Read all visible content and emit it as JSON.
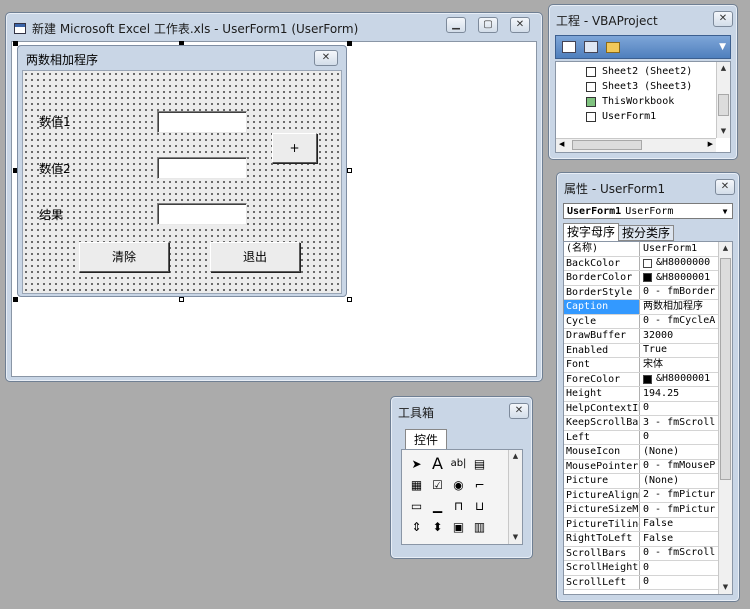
{
  "editor_window": {
    "title": "新建 Microsoft Excel 工作表.xls - UserForm1 (UserForm)"
  },
  "userform": {
    "caption": "两数相加程序",
    "labels": {
      "value1": "数值1",
      "value2": "数值2",
      "result": "结果"
    },
    "buttons": {
      "add": "+",
      "clear": "清除",
      "exit": "退出"
    }
  },
  "project_window": {
    "title": "工程 - VBAProject",
    "tree_items": [
      {
        "label": "Sheet2 (Sheet2)",
        "icon": "sheet-icon"
      },
      {
        "label": "Sheet3 (Sheet3)",
        "icon": "sheet-icon"
      },
      {
        "label": "ThisWorkbook",
        "icon": "workbook-icon"
      },
      {
        "label": "UserForm1",
        "icon": "userform-icon"
      }
    ]
  },
  "properties_window": {
    "title": "属性 - UserForm1",
    "object_select": {
      "name": "UserForm1",
      "type": "UserForm"
    },
    "tabs": [
      "按字母序",
      "按分类序"
    ],
    "rows": [
      {
        "name": "(名称)",
        "value": "UserForm1"
      },
      {
        "name": "BackColor",
        "value": "&H8000000",
        "swatch": "#ffffff"
      },
      {
        "name": "BorderColor",
        "value": "&H8000001",
        "swatch": "#000000"
      },
      {
        "name": "BorderStyle",
        "value": "0 - fmBorder"
      },
      {
        "name": "Caption",
        "value": "两数相加程序",
        "selected": true
      },
      {
        "name": "Cycle",
        "value": "0 - fmCycleA"
      },
      {
        "name": "DrawBuffer",
        "value": "32000"
      },
      {
        "name": "Enabled",
        "value": "True"
      },
      {
        "name": "Font",
        "value": "宋体"
      },
      {
        "name": "ForeColor",
        "value": "&H8000001",
        "swatch": "#000000"
      },
      {
        "name": "Height",
        "value": "194.25"
      },
      {
        "name": "HelpContextID",
        "value": "0"
      },
      {
        "name": "KeepScrollBar",
        "value": "3 - fmScroll"
      },
      {
        "name": "Left",
        "value": "0"
      },
      {
        "name": "MouseIcon",
        "value": "(None)"
      },
      {
        "name": "MousePointer",
        "value": "0 - fmMouseP"
      },
      {
        "name": "Picture",
        "value": "(None)"
      },
      {
        "name": "PictureAlignm",
        "value": "2 - fmPictur"
      },
      {
        "name": "PictureSizeMo",
        "value": "0 - fmPictur"
      },
      {
        "name": "PictureTiling",
        "value": "False"
      },
      {
        "name": "RightToLeft",
        "value": "False"
      },
      {
        "name": "ScrollBars",
        "value": "0 - fmScroll"
      },
      {
        "name": "ScrollHeight",
        "value": "0"
      },
      {
        "name": "ScrollLeft",
        "value": "0"
      }
    ]
  },
  "toolbox": {
    "title": "工具箱",
    "tab": "控件",
    "tools": [
      {
        "icon": "pointer-icon",
        "glyph": "➤"
      },
      {
        "icon": "label-tool-icon",
        "glyph": "A"
      },
      {
        "icon": "textbox-tool-icon",
        "glyph": "ab|"
      },
      {
        "icon": "combobox-tool-icon",
        "glyph": "▤"
      },
      {
        "icon": "listbox-tool-icon",
        "glyph": "▦"
      },
      {
        "icon": "checkbox-tool-icon",
        "glyph": "☑"
      },
      {
        "icon": "optionbutton-tool-icon",
        "glyph": "◉"
      },
      {
        "icon": "togglebutton-tool-icon",
        "glyph": "⌐"
      },
      {
        "icon": "frame-tool-icon",
        "glyph": "▭"
      },
      {
        "icon": "commandbutton-tool-icon",
        "glyph": "▁"
      },
      {
        "icon": "tabstrip-tool-icon",
        "glyph": "⊓"
      },
      {
        "icon": "multipage-tool-icon",
        "glyph": "⊔"
      },
      {
        "icon": "scrollbar-tool-icon",
        "glyph": "⇕"
      },
      {
        "icon": "spinbutton-tool-icon",
        "glyph": "⬍"
      },
      {
        "icon": "image-tool-icon",
        "glyph": "▣"
      },
      {
        "icon": "refedit-tool-icon",
        "glyph": "▥"
      }
    ]
  }
}
